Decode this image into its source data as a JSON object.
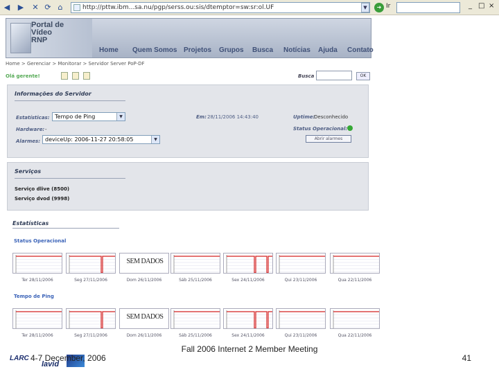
{
  "browser": {
    "address": "http://pttw.ibm...sa.nu/pgp/serss.ou:sis/dtemptor=sw:sr:ol.UF",
    "go_label": "Ir",
    "search_value": "",
    "back_icon": "back-arrow-icon",
    "forward_icon": "forward-arrow-icon"
  },
  "site": {
    "logo_text": "Portal de\nVídeo\nRNP",
    "nav": [
      "Home",
      "Quem Somos",
      "Projetos",
      "Grupos",
      "Busca",
      "Notícias",
      "Ajuda",
      "Contato"
    ]
  },
  "breadcrumb": "Home > Gerenciar > Monitorar > Servidor Server PoP-DF",
  "greeting": "Olá gerente!",
  "search": {
    "label": "Busca",
    "button": "OK"
  },
  "server": {
    "title": "Informações do Servidor",
    "stats_label": "Estatísticas:",
    "stats_value": "Tempo de Ping",
    "hardware_label": "Hardware:",
    "hardware_value": "-",
    "alarms_label": "Alarmes:",
    "alarms_value": "deviceUp: 2006-11-27 20:58:05",
    "em_label": "Em:",
    "em_value": "28/11/2006 14:43:40",
    "uptime_label": "Uptime:",
    "uptime_value": "Desconhecido",
    "status_label": "Status Operacional:",
    "status_color": "#35a835",
    "alarm_button": "Abrir alarmes"
  },
  "services": {
    "title": "Serviços",
    "items": [
      "Serviço dlive (8500)",
      "Serviço dvod (9998)"
    ]
  },
  "stats": {
    "title": "Estatísticas",
    "sections": [
      {
        "title": "Status Operacional",
        "thumbs": [
          {
            "label": "Ter 28/11/2006",
            "text": ""
          },
          {
            "label": "Seg 27/11/2006",
            "text": ""
          },
          {
            "label": "Dom 26/11/2006",
            "text": "SEM DADOS"
          },
          {
            "label": "Sáb 25/11/2006",
            "text": ""
          },
          {
            "label": "Sex 24/11/2006",
            "text": ""
          },
          {
            "label": "Qui 23/11/2006",
            "text": ""
          },
          {
            "label": "Qua 22/11/2006",
            "text": ""
          }
        ]
      },
      {
        "title": "Tempo de Ping",
        "thumbs": [
          {
            "label": "Ter 28/11/2006",
            "text": ""
          },
          {
            "label": "Seg 27/11/2006",
            "text": ""
          },
          {
            "label": "Dom 26/11/2006",
            "text": "SEM DADOS"
          },
          {
            "label": "Sáb 25/11/2006",
            "text": ""
          },
          {
            "label": "Sex 24/11/2006",
            "text": ""
          },
          {
            "label": "Qui 23/11/2006",
            "text": ""
          },
          {
            "label": "Qua 22/11/2006",
            "text": ""
          }
        ]
      }
    ]
  },
  "footer": {
    "logo_a": "LARC",
    "logo_b": "lavid",
    "date": "4-7 December, 2006",
    "conference": "Fall 2006 Internet 2 Member Meeting",
    "page": "41"
  }
}
